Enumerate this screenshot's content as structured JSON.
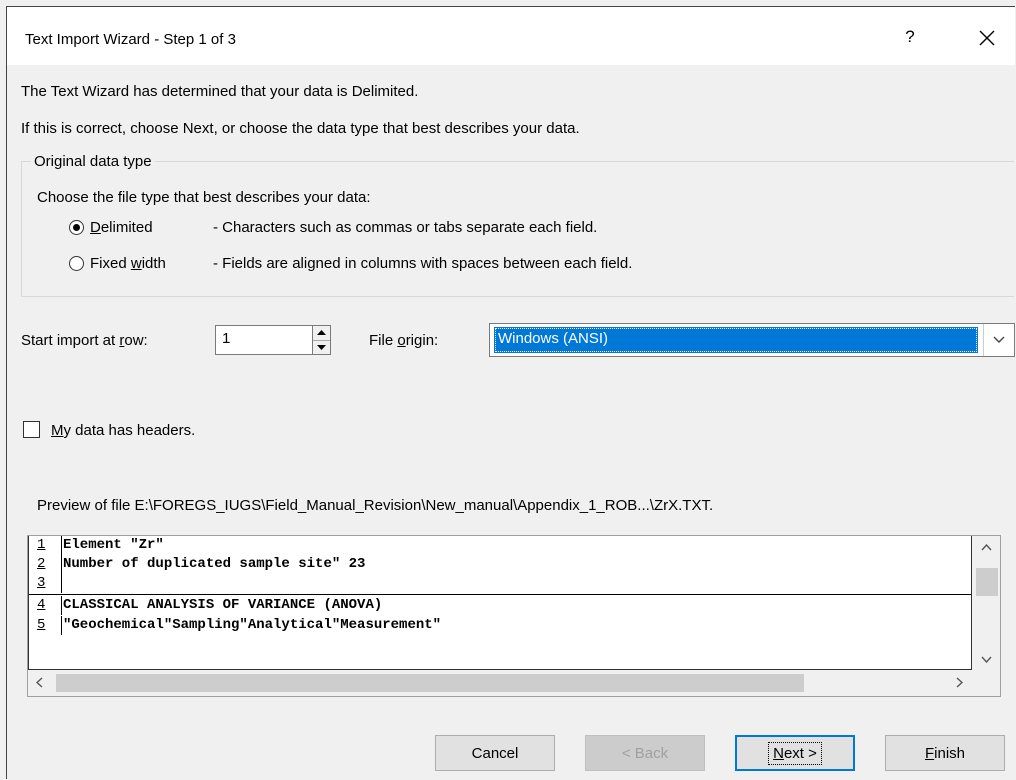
{
  "dialog": {
    "title": "Text Import Wizard - Step 1 of 3",
    "help_label": "?"
  },
  "intro": {
    "line1": "The Text Wizard has determined that your data is Delimited.",
    "line2": "If this is correct, choose Next, or choose the data type that best describes your data."
  },
  "data_type_group": {
    "legend": "Original data type",
    "prompt": "Choose the file type that best describes your data:",
    "options": [
      {
        "label": "Delimited",
        "mnemonic": "D",
        "rest": "elimited",
        "description": "- Characters such as commas or tabs separate each field.",
        "selected": true
      },
      {
        "label": "Fixed width",
        "prefix": "Fixed ",
        "mnemonic": "w",
        "rest": "idth",
        "description": "- Fields are aligned in columns with spaces between each field.",
        "selected": false
      }
    ]
  },
  "start_row": {
    "label_prefix": "Start import at ",
    "label_mnemonic": "r",
    "label_suffix": "ow:",
    "value": "1"
  },
  "file_origin": {
    "label_prefix": "File ",
    "label_mnemonic": "o",
    "label_suffix": "rigin:",
    "value": "Windows (ANSI)"
  },
  "headers_checkbox": {
    "mnemonic": "M",
    "rest": "y data has headers.",
    "checked": false
  },
  "preview": {
    "label": "Preview of file E:\\FOREGS_IUGS\\Field_Manual_Revision\\New_manual\\Appendix_1_ROB...\\ZrX.TXT.",
    "lines": [
      {
        "num": "1",
        "text": "Element \"Zr\""
      },
      {
        "num": "2",
        "text": "Number of duplicated sample site\"  23"
      },
      {
        "num": "3",
        "text": ""
      },
      {
        "num": "4",
        "text": "CLASSICAL ANALYSIS OF VARIANCE (ANOVA)"
      },
      {
        "num": "5",
        "text": " \"Geochemical\"Sampling\"Analytical\"Measurement\""
      }
    ]
  },
  "buttons": {
    "cancel": "Cancel",
    "back": "< Back",
    "next_mnemonic": "N",
    "next_rest": "ext >",
    "finish_mnemonic": "F",
    "finish_rest": "inish"
  },
  "colors": {
    "selection": "#0078d7",
    "dialog_bg": "#f0f0f0"
  }
}
